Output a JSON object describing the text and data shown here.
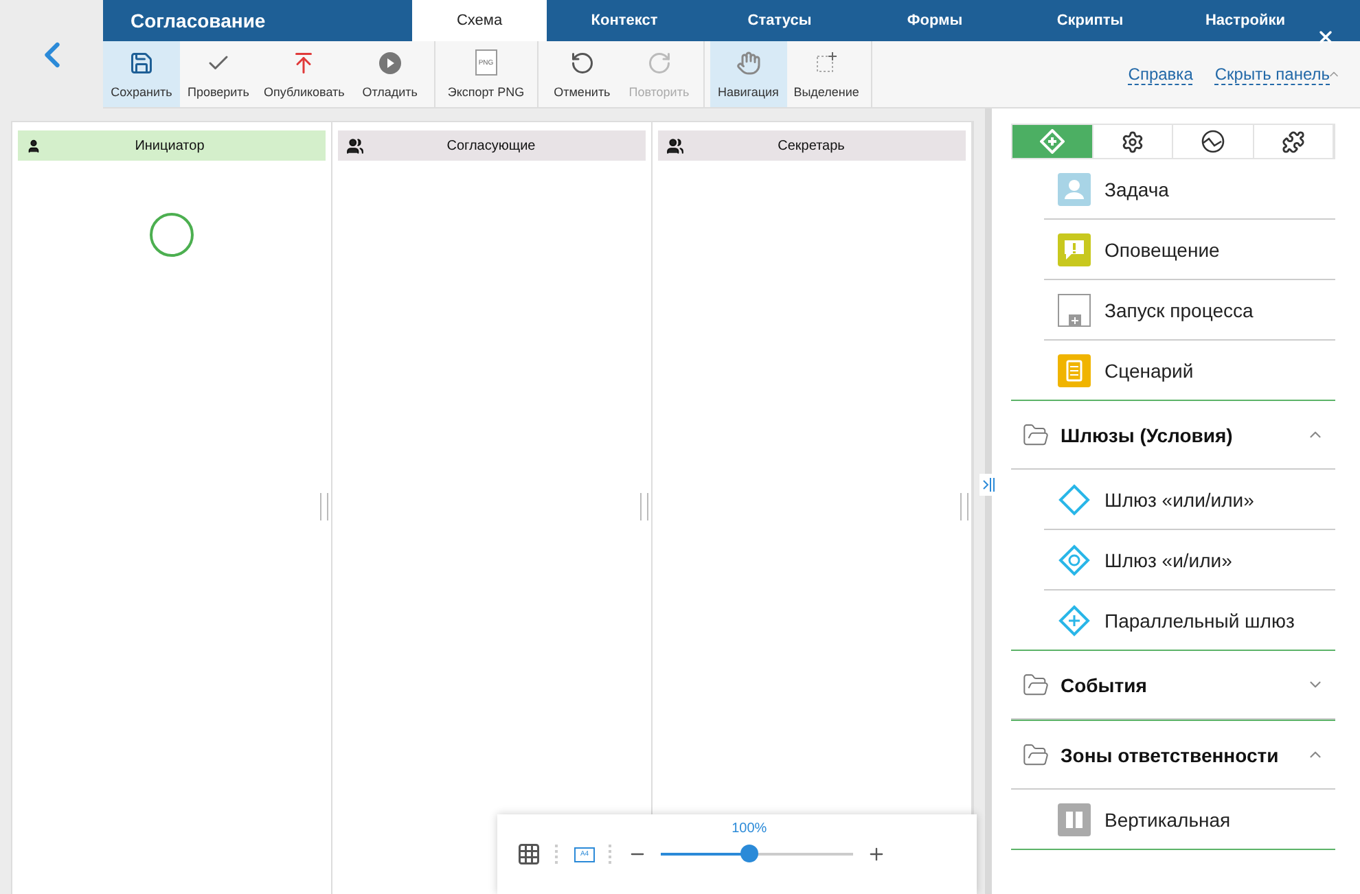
{
  "app": {
    "title": "Согласование"
  },
  "tabs": [
    {
      "label": "Схема",
      "selected": true
    },
    {
      "label": "Контекст",
      "selected": false
    },
    {
      "label": "Статусы",
      "selected": false
    },
    {
      "label": "Формы",
      "selected": false
    },
    {
      "label": "Скрипты",
      "selected": false
    },
    {
      "label": "Настройки",
      "selected": false
    }
  ],
  "toolbar": [
    [
      {
        "kind": "save",
        "label": "Сохранить",
        "selected": true,
        "disabled": false
      },
      {
        "kind": "check",
        "label": "Проверить",
        "selected": false,
        "disabled": false
      },
      {
        "kind": "publish",
        "label": "Опубликовать",
        "selected": false,
        "disabled": false
      },
      {
        "kind": "debug",
        "label": "Отладить",
        "selected": false,
        "disabled": false
      }
    ],
    [
      {
        "kind": "export",
        "label": "Экспорт PNG",
        "icon_text": "PNG",
        "selected": false,
        "disabled": false
      }
    ],
    [
      {
        "kind": "undo",
        "label": "Отменить",
        "selected": false,
        "disabled": false
      },
      {
        "kind": "redo",
        "label": "Повторить",
        "selected": false,
        "disabled": true
      }
    ],
    [
      {
        "kind": "hand",
        "label": "Навигация",
        "selected": true,
        "disabled": false
      },
      {
        "kind": "select",
        "label": "Выделение",
        "selected": false,
        "disabled": false
      }
    ]
  ],
  "links": [
    "Справка",
    "Скрыть панель"
  ],
  "lanes": [
    {
      "kind": "single",
      "title": "Инициатор",
      "selected": true,
      "start_event": true
    },
    {
      "kind": "group",
      "title": "Согласующие",
      "selected": false,
      "start_event": false
    },
    {
      "kind": "group",
      "title": "Секретарь",
      "selected": false,
      "start_event": false
    }
  ],
  "zoom": {
    "page_size": "A4",
    "reading": "100%",
    "level": 0.46
  },
  "panel_tabs": [
    {
      "kind": "elements",
      "selected": true
    },
    {
      "kind": "settings",
      "selected": false
    },
    {
      "kind": "chart",
      "selected": false
    },
    {
      "kind": "plugins",
      "selected": false
    }
  ],
  "groups": [
    {
      "items": [
        {
          "kind": "task",
          "label": "Задача"
        },
        {
          "kind": "notification",
          "label": "Оповещение"
        },
        {
          "kind": "subprocess",
          "label": "Запуск процесса"
        },
        {
          "kind": "script",
          "label": "Сценарий"
        }
      ]
    },
    {
      "title": "Шлюзы (Условия)",
      "expanded": true,
      "items": [
        {
          "kind": "gateway_xor",
          "label": "Шлюз «или/или»"
        },
        {
          "kind": "gateway_or",
          "label": "Шлюз «и/или»"
        },
        {
          "kind": "gateway_parallel",
          "label": "Параллельный шлюз"
        }
      ]
    },
    {
      "title": "События",
      "expanded": false
    },
    {
      "title": "Зоны ответственности",
      "expanded": true,
      "items": [
        {
          "kind": "lane_vertical",
          "label": "Вертикальная"
        }
      ]
    }
  ]
}
